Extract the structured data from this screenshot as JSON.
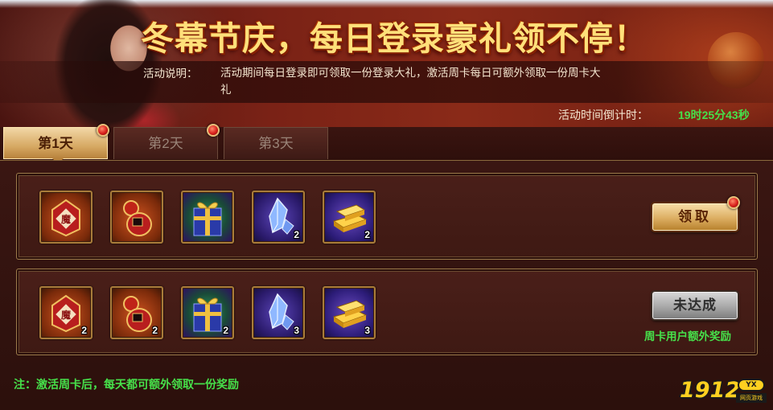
{
  "banner": {
    "title": "冬幕节庆，每日登录豪礼领不停！",
    "desc_label": "活动说明：",
    "desc_text": "活动期间每日登录即可领取一份登录大礼，激活周卡每日可额外领取一份周卡大礼",
    "countdown_label": "活动时间倒计时：",
    "countdown_value": "19时25分43秒"
  },
  "tabs": [
    {
      "label": "第1天",
      "active": true
    },
    {
      "label": "第2天",
      "active": false
    },
    {
      "label": "第3天",
      "active": false
    }
  ],
  "rows": [
    {
      "items": [
        {
          "icon": "red-seal-pouch-icon",
          "count": ""
        },
        {
          "icon": "red-gourd-bag-icon",
          "count": ""
        },
        {
          "icon": "blue-gift-box-icon",
          "count": ""
        },
        {
          "icon": "blue-crystal-icon",
          "count": "2"
        },
        {
          "icon": "gold-ingot-icon",
          "count": "2"
        }
      ],
      "button_label": "领取",
      "note": ""
    },
    {
      "items": [
        {
          "icon": "red-seal-pouch-icon",
          "count": "2"
        },
        {
          "icon": "red-gourd-bag-icon",
          "count": "2"
        },
        {
          "icon": "blue-gift-box-icon",
          "count": "2"
        },
        {
          "icon": "blue-crystal-icon",
          "count": "3"
        },
        {
          "icon": "gold-ingot-icon",
          "count": "3"
        }
      ],
      "button_label": "未达成",
      "note": "周卡用户额外奖励"
    }
  ],
  "footnote": "注：激活周卡后，每天都可额外领取一份奖励",
  "logo": {
    "text": "1912",
    "badge": "YX",
    "sub": "网页游戏"
  },
  "colors": {
    "accent_green": "#46e04a",
    "title_gold": "#ffe07a",
    "frame_gold": "#a97c3a"
  }
}
